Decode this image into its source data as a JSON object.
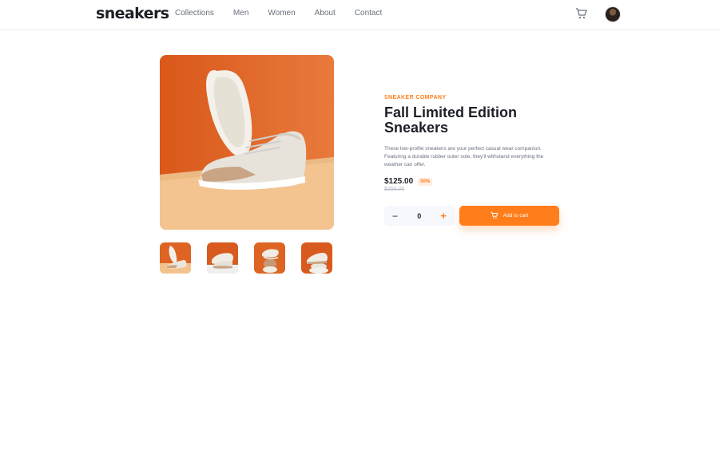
{
  "header": {
    "logo": "sneakers",
    "nav": [
      "Collections",
      "Men",
      "Women",
      "About",
      "Contact"
    ],
    "cart_icon": "cart-icon",
    "avatar_icon": "avatar"
  },
  "gallery": {
    "main_image": "product-image-1",
    "thumbnails": [
      "product-thumbnail-1",
      "product-thumbnail-2",
      "product-thumbnail-3",
      "product-thumbnail-4"
    ]
  },
  "product": {
    "company": "SNEAKER COMPANY",
    "title": "Fall Limited Edition Sneakers",
    "description": "These low-profile sneakers are your perfect casual wear companion. Featuring a durable rubber outer sole, they'll withstand everything the weather can offer.",
    "price": "$125.00",
    "discount": "50%",
    "old_price": "$250.00"
  },
  "cart_controls": {
    "minus_label": "−",
    "quantity": "0",
    "plus_label": "+",
    "add_label": "Add to cart"
  },
  "colors": {
    "accent": "#ff7e1b",
    "accent_pale": "#ffede0",
    "text_dark": "#1d2026",
    "text_grey": "#69707d"
  }
}
